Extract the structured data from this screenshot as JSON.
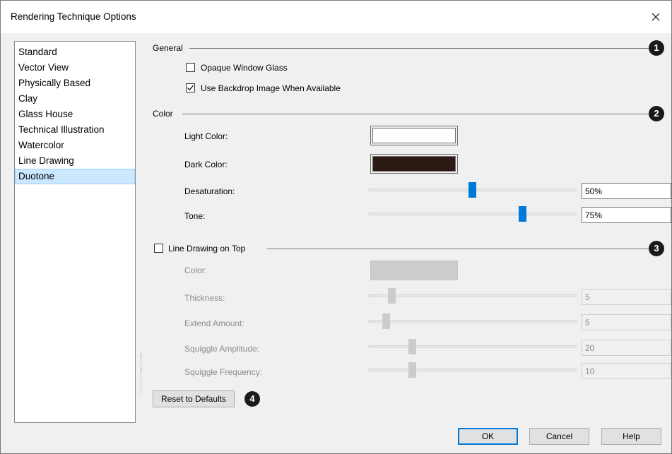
{
  "window": {
    "title": "Rendering Technique Options"
  },
  "techniques": {
    "items": [
      "Standard",
      "Vector View",
      "Physically Based",
      "Clay",
      "Glass House",
      "Technical Illustration",
      "Watercolor",
      "Line Drawing",
      "Duotone"
    ],
    "selected": "Duotone"
  },
  "general": {
    "label": "General",
    "badge": "1",
    "opaque_glass": {
      "label": "Opaque Window Glass",
      "checked": false
    },
    "backdrop": {
      "label": "Use Backdrop Image When Available",
      "checked": true
    }
  },
  "color": {
    "label": "Color",
    "badge": "2",
    "light": {
      "label": "Light Color:",
      "swatch": "#ffffff"
    },
    "dark": {
      "label": "Dark Color:",
      "swatch": "#2c1a14"
    },
    "desaturation": {
      "label": "Desaturation:",
      "value": "50%",
      "level": 0.5
    },
    "tone": {
      "label": "Tone:",
      "value": "75%",
      "level": 0.75
    }
  },
  "line_drawing": {
    "label": "Line Drawing on Top",
    "checked": false,
    "badge": "3",
    "color": {
      "label": "Color:",
      "swatch": "#cccccc"
    },
    "thickness": {
      "label": "Thickness:",
      "value": "5",
      "level": 0.1
    },
    "extend": {
      "label": "Extend Amount:",
      "value": "5",
      "level": 0.07
    },
    "amplitude": {
      "label": "Squiggle Amplitude:",
      "value": "20",
      "level": 0.2
    },
    "frequency": {
      "label": "Squiggle Frequency:",
      "value": "10",
      "level": 0.2
    }
  },
  "footer": {
    "reset_label": "Reset to Defaults",
    "reset_badge": "4",
    "ok_label": "OK",
    "cancel_label": "Cancel",
    "help_label": "Help"
  },
  "colors": {
    "accent": "#0078d7",
    "selection": "#cce8ff",
    "disabled": "#cccccc"
  },
  "icons": {
    "close": "close-icon",
    "check": "check-icon"
  }
}
